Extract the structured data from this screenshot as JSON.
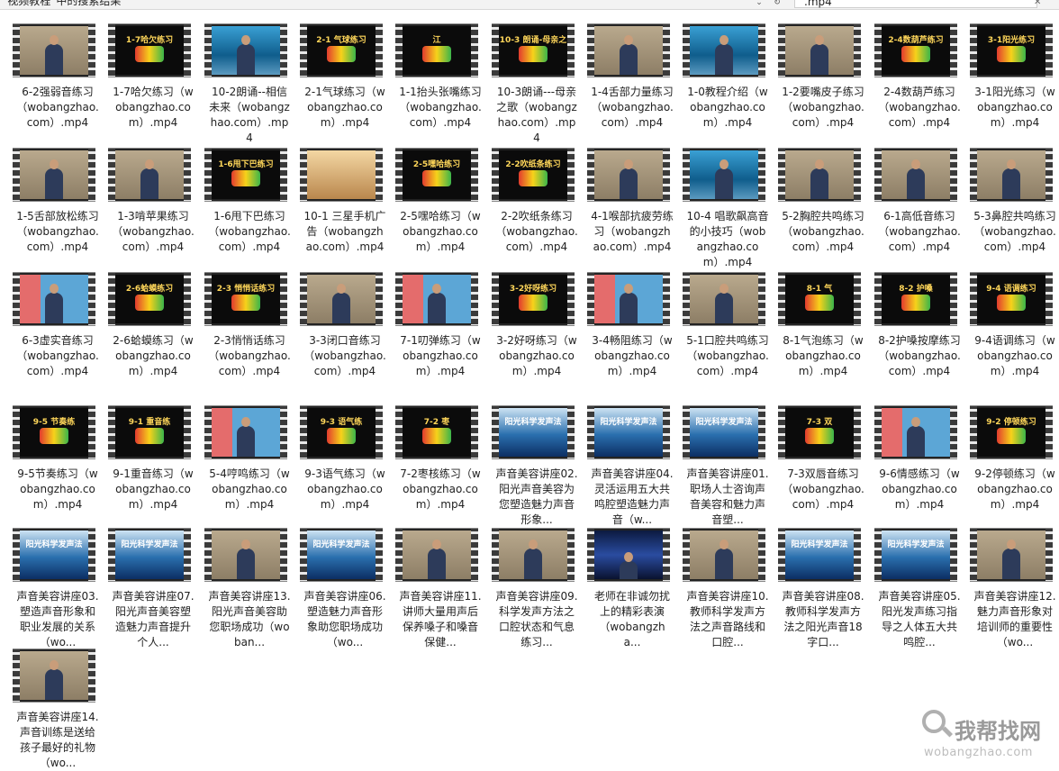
{
  "toolbar": {
    "address": "“视频教程”中的搜索结果",
    "search_value": ".mp4",
    "dropdown_icon": "chevron-down-icon",
    "refresh_icon": "refresh-icon",
    "clear_icon": "close-icon"
  },
  "files": [
    {
      "name": "6-2强弱音练习（wobangzhao.com）.mp4",
      "thumb": "person",
      "title": ""
    },
    {
      "name": "1-7哈欠练习（wobangzhao.com）.mp4",
      "thumb": "black",
      "title": "1-7哈欠练习"
    },
    {
      "name": "10-2朗诵--相信未来（wobangzhao.com）.mp4",
      "thumb": "blue",
      "title": ""
    },
    {
      "name": "2-1气球练习（wobangzhao.com）.mp4",
      "thumb": "black",
      "title": "2-1 气球练习"
    },
    {
      "name": "1-1抬头张嘴练习（wobangzhao.com）.mp4",
      "thumb": "black",
      "title": "江"
    },
    {
      "name": "10-3朗诵---母亲之歌（wobangzhao.com）.mp4",
      "thumb": "black",
      "title": "10-3 朗诵-母亲之歌"
    },
    {
      "name": "1-4舌部力量练习（wobangzhao.com）.mp4",
      "thumb": "person",
      "title": ""
    },
    {
      "name": "1-0教程介绍（wobangzhao.com）.mp4",
      "thumb": "blue",
      "title": ""
    },
    {
      "name": "1-2要嘴皮子练习（wobangzhao.com）.mp4",
      "thumb": "person",
      "title": ""
    },
    {
      "name": "2-4数葫芦练习（wobangzhao.com）.mp4",
      "thumb": "black",
      "title": "2-4数葫芦练习"
    },
    {
      "name": "3-1阳光练习（wobangzhao.com）.mp4",
      "thumb": "black",
      "title": "3-1阳光练习"
    },
    {
      "name": "1-5舌部放松练习（wobangzhao.com）.mp4",
      "thumb": "person",
      "title": ""
    },
    {
      "name": "1-3啃苹果练习（wobangzhao.com）.mp4",
      "thumb": "person",
      "title": ""
    },
    {
      "name": "1-6甩下巴练习（wobangzhao.com）.mp4",
      "thumb": "black",
      "title": "1-6甩下巴练习"
    },
    {
      "name": "10-1 三星手机广告（wobangzhao.com）.mp4",
      "thumb": "orange",
      "title": ""
    },
    {
      "name": "2-5嘿哈练习（wobangzhao.com）.mp4",
      "thumb": "black",
      "title": "2-5嘿哈练习"
    },
    {
      "name": "2-2吹纸条练习（wobangzhao.com）.mp4",
      "thumb": "black",
      "title": "2-2吹纸条练习"
    },
    {
      "name": "4-1喉部抗疲劳练习（wobangzhao.com）.mp4",
      "thumb": "person",
      "title": ""
    },
    {
      "name": "10-4 唱歌飙高音的小技巧（wobangzhao.com）.mp4",
      "thumb": "blue",
      "title": ""
    },
    {
      "name": "5-2胸腔共鸣练习（wobangzhao.com）.mp4",
      "thumb": "person",
      "title": ""
    },
    {
      "name": "6-1高低音练习（wobangzhao.com）.mp4",
      "thumb": "person",
      "title": ""
    },
    {
      "name": "5-3鼻腔共鸣练习（wobangzhao.com）.mp4",
      "thumb": "person",
      "title": ""
    },
    {
      "name": "6-3虚实音练习（wobangzhao.com）.mp4",
      "thumb": "pink",
      "title": ""
    },
    {
      "name": "2-6蛤蟆练习（wobangzhao.com）.mp4",
      "thumb": "black",
      "title": "2-6蛤蟆练习"
    },
    {
      "name": "2-3悄悄话练习（wobangzhao.com）.mp4",
      "thumb": "black",
      "title": "2-3 悄悄话练习"
    },
    {
      "name": "3-3闭口音练习（wobangzhao.com）.mp4",
      "thumb": "person",
      "title": ""
    },
    {
      "name": "7-1叨弹练习（wobangzhao.com）.mp4",
      "thumb": "pink",
      "title": ""
    },
    {
      "name": "3-2好呀练习（wobangzhao.com）.mp4",
      "thumb": "black",
      "title": "3-2好呀练习"
    },
    {
      "name": "3-4畅阻练习（wobangzhao.com）.mp4",
      "thumb": "pink",
      "title": ""
    },
    {
      "name": "5-1口腔共鸣练习（wobangzhao.com）.mp4",
      "thumb": "person",
      "title": ""
    },
    {
      "name": "8-1气泡练习（wobangzhao.com）.mp4",
      "thumb": "black",
      "title": "8-1 气"
    },
    {
      "name": "8-2护嗓按摩练习（wobangzhao.com）.mp4",
      "thumb": "black",
      "title": "8-2 护嗓"
    },
    {
      "name": "9-4语调练习（wobangzhao.com）.mp4",
      "thumb": "black",
      "title": "9-4 语调练习"
    },
    {
      "name": "9-5节奏练习（wobangzhao.com）.mp4",
      "thumb": "black",
      "title": "9-5 节奏练"
    },
    {
      "name": "9-1重音练习（wobangzhao.com）.mp4",
      "thumb": "black",
      "title": "9-1 重音练"
    },
    {
      "name": "5-4哼鸣练习（wobangzhao.com）.mp4",
      "thumb": "pink",
      "title": ""
    },
    {
      "name": "9-3语气练习（wobangzhao.com）.mp4",
      "thumb": "black",
      "title": "9-3 语气练"
    },
    {
      "name": "7-2枣核练习（wobangzhao.com）.mp4",
      "thumb": "black",
      "title": "7-2 枣"
    },
    {
      "name": "声音美容讲座02.阳光声音美容为您塑造魅力声音形象...",
      "thumb": "wave",
      "title": "阳光科学发声法"
    },
    {
      "name": "声音美容讲座04.灵活运用五大共鸣腔塑造魅力声音（w...",
      "thumb": "wave",
      "title": "阳光科学发声法"
    },
    {
      "name": "声音美容讲座01.职场人士咨询声音美容和魅力声音塑...",
      "thumb": "wave",
      "title": "阳光科学发声法"
    },
    {
      "name": "7-3双唇音练习（wobangzhao.com）.mp4",
      "thumb": "black",
      "title": "7-3 双"
    },
    {
      "name": "9-6情感练习（wobangzhao.com）.mp4",
      "thumb": "pink",
      "title": ""
    },
    {
      "name": "9-2停顿练习（wobangzhao.com）.mp4",
      "thumb": "black",
      "title": "9-2 停顿练习"
    },
    {
      "name": "声音美容讲座03.塑造声音形象和职业发展的关系（wo...",
      "thumb": "wave",
      "title": "阳光科学发声法"
    },
    {
      "name": "声音美容讲座07.阳光声音美容塑造魅力声音提升个人...",
      "thumb": "wave",
      "title": "阳光科学发声法"
    },
    {
      "name": "声音美容讲座13.阳光声音美容助您职场成功（woban...",
      "thumb": "person",
      "title": ""
    },
    {
      "name": "声音美容讲座06.塑造魅力声音形象助您职场成功（wo...",
      "thumb": "wave",
      "title": "阳光科学发声法"
    },
    {
      "name": "声音美容讲座11.讲师大量用声后保养嗓子和嗓音保健...",
      "thumb": "person",
      "title": ""
    },
    {
      "name": "声音美容讲座09.科学发声方法之口腔状态和气息练习...",
      "thumb": "person",
      "title": ""
    },
    {
      "name": "老师在非诚勿扰上的精彩表演（wobangzha...",
      "thumb": "stage",
      "title": ""
    },
    {
      "name": "声音美容讲座10.教师科学发声方法之声音路线和口腔...",
      "thumb": "person",
      "title": ""
    },
    {
      "name": "声音美容讲座08.教师科学发声方法之阳光声音18字口...",
      "thumb": "wave",
      "title": "阳光科学发声法"
    },
    {
      "name": "声音美容讲座05.阳光发声练习指导之人体五大共鸣腔...",
      "thumb": "wave",
      "title": "阳光科学发声法"
    },
    {
      "name": "声音美容讲座12.魅力声音形象对培训师的重要性（wo...",
      "thumb": "person",
      "title": ""
    },
    {
      "name": "声音美容讲座14.声音训练是送给孩子最好的礼物（wo...",
      "thumb": "person",
      "title": ""
    }
  ],
  "watermark": {
    "cn": "我帮找网",
    "url": "wobangzhao.com",
    "icon": "magnifier-icon"
  }
}
